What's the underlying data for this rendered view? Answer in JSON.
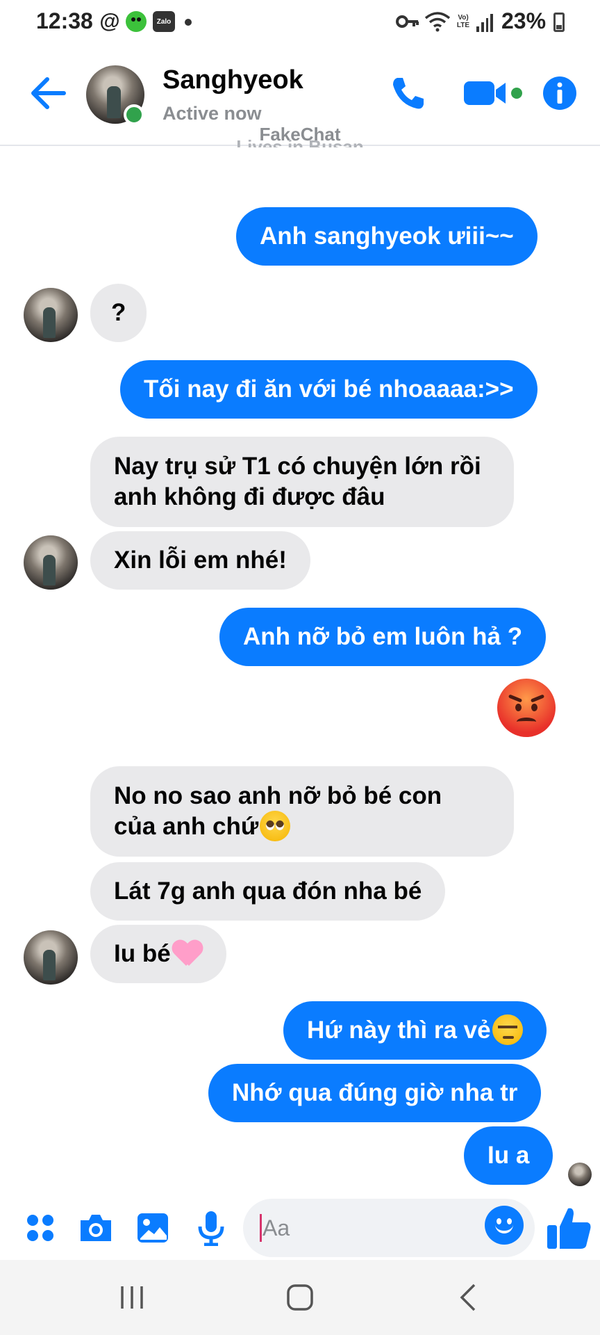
{
  "status_bar": {
    "time": "12:38",
    "threads_glyph": "@",
    "zalo_label": "Zalo",
    "lte_top": "Vo)",
    "lte_bottom": "LTE",
    "battery": "23%",
    "icons": [
      "threads-icon",
      "robot-app-icon",
      "zalo-icon",
      "notification-dot-icon",
      "vpn-key-icon",
      "wifi-icon",
      "volte-icon",
      "signal-icon",
      "battery-icon"
    ]
  },
  "header": {
    "contact_name": "Sanghyeok",
    "status": "Active now",
    "accent_color": "#0a7cff",
    "online_color": "#31a24c"
  },
  "watermark": "FakeChat",
  "profile_hint": "Lives in Busan",
  "messages": [
    {
      "from": "me",
      "text": "Anh sanghyeok ưiii~~"
    },
    {
      "from": "them",
      "text": "?"
    },
    {
      "from": "me",
      "text": "Tối nay đi ăn với bé nhoaaaa:>>"
    },
    {
      "from": "them",
      "text": "Nay trụ sử T1 có chuyện lớn rồi anh không đi được đâu"
    },
    {
      "from": "them",
      "text": "Xin lỗi em nhé!"
    },
    {
      "from": "me",
      "text": "Anh nỡ bỏ em luôn hả ?"
    },
    {
      "from": "me",
      "emoji": "angry-face"
    },
    {
      "from": "them",
      "text": "No no sao anh nỡ bỏ bé con của anh chứ",
      "emoji": "pleading-face"
    },
    {
      "from": "them",
      "text": "Lát 7g anh qua đón nha bé"
    },
    {
      "from": "them",
      "text": "Iu bé",
      "emoji": "pink-heart"
    },
    {
      "from": "me",
      "text": "Hứ này thì ra vẻ",
      "emoji": "unamused-face"
    },
    {
      "from": "me",
      "text": "Nhớ qua đúng giờ nha tr"
    },
    {
      "from": "me",
      "text": "Iu a"
    }
  ],
  "composer": {
    "placeholder": "Aa",
    "value": ""
  }
}
